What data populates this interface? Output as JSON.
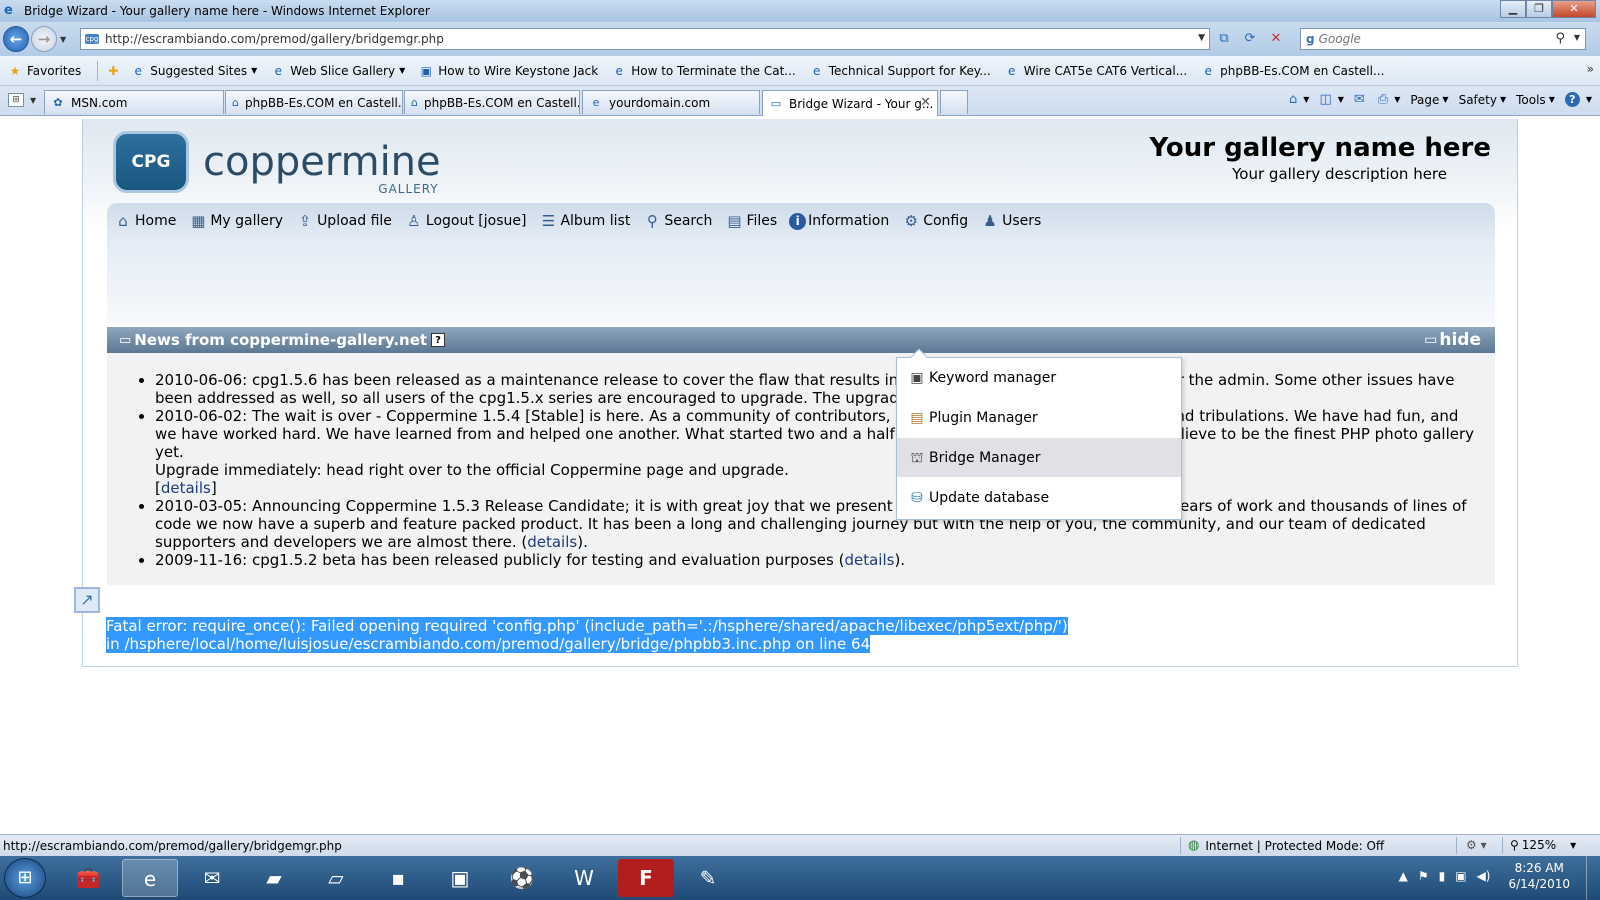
{
  "window": {
    "title": "Bridge Wizard - Your gallery name here - Windows Internet Explorer",
    "minimize": "▁",
    "maximize": "❐",
    "close": "✕"
  },
  "address_bar": {
    "url": "http://escrambiando.com/premod/gallery/bridgemgr.php",
    "search_placeholder": "Google"
  },
  "favorites_bar": {
    "favorites_label": "Favorites",
    "items": [
      "Suggested Sites",
      "Web Slice Gallery",
      "How to Wire Keystone Jack",
      "How to Terminate the Cat...",
      "Technical Support for Key...",
      "Wire CAT5e CAT6 Vertical...",
      "phpBB-Es.COM en Castell..."
    ]
  },
  "tabs": [
    {
      "label": "MSN.com"
    },
    {
      "label": "phpBB-Es.COM en Castell..."
    },
    {
      "label": "phpBB-Es.COM en Castell..."
    },
    {
      "label": "yourdomain.com"
    },
    {
      "label": "Bridge Wizard - Your g..."
    }
  ],
  "command_bar": {
    "page": "Page",
    "safety": "Safety",
    "tools": "Tools",
    "help": "?"
  },
  "gallery": {
    "logo_abbrev": "CPG",
    "logo_name": "coppermine",
    "logo_sub": "GALLERY",
    "title": "Your gallery name here",
    "description": "Your gallery description here"
  },
  "menu": [
    {
      "label": "Home",
      "icon": "home-icon"
    },
    {
      "label": "My gallery",
      "icon": "my-gallery-icon"
    },
    {
      "label": "Upload file",
      "icon": "upload-icon"
    },
    {
      "label": "Logout [josue]",
      "icon": "logout-icon"
    },
    {
      "label": "Album list",
      "icon": "album-list-icon"
    },
    {
      "label": "Search",
      "icon": "search-icon"
    },
    {
      "label": "Files",
      "icon": "files-icon"
    },
    {
      "label": "Information",
      "icon": "information-icon"
    },
    {
      "label": "Config",
      "icon": "gear-icon"
    },
    {
      "label": "Users",
      "icon": "users-icon"
    }
  ],
  "config_dropdown": [
    {
      "label": "Keyword manager"
    },
    {
      "label": "Plugin Manager"
    },
    {
      "label": "Bridge Manager"
    },
    {
      "label": "Update database"
    }
  ],
  "news": {
    "title": "News from coppermine-gallery.net",
    "help": "?",
    "hide": "hide",
    "items": [
      {
        "text": "2010-06-06: cpg1.5.6 has been released as a maintenance release to cover the flaw that results in an error message being displayed for the admin. Some other issues have been addressed as well, so all users of the cpg1.5.x series are encouraged to upgrade. The upgrade is not security-related."
      },
      {
        "text": "2010-06-02: The wait is over - Coppermine 1.5.4 [Stable] is here. As a community of contributors, we have been through celebrations and tribulations. We have had fun, and we have worked hard. We have learned from and helped one another. What started two and a half years ago has grown into what we believe to be the finest PHP photo gallery yet.",
        "line2": "Upgrade immediately: head right over to the official Coppermine page and upgrade.",
        "link": "details"
      },
      {
        "text": "2010-03-05: Announcing Coppermine 1.5.3 Release Candidate; it is with great joy that we present Coppermine 1.5.3 [RC]. After over 2 years of work and thousands of lines of code we now have a superb and feature packed product. It has been a long and challenging journey but with the help of you, the community, and our team of dedicated supporters and developers we are almost there. (",
        "link": "details",
        "tail": ")."
      },
      {
        "text": "2009-11-16: cpg1.5.2 beta has been released publicly for testing and evaluation purposes (",
        "link": "details",
        "tail": ")."
      }
    ]
  },
  "error": {
    "line1": "Fatal error: require_once(): Failed opening required 'config.php' (include_path='.:/hsphere/shared/apache/libexec/php5ext/php/')",
    "line2": "in /hsphere/local/home/luisjosue/escrambiando.com/premod/gallery/bridge/phpbb3.inc.php on line 64"
  },
  "status_bar": {
    "url": "http://escrambiando.com/premod/gallery/bridgemgr.php",
    "zone": "Internet | Protected Mode: Off",
    "zoom": "125%"
  },
  "taskbar": {
    "time": "8:26 AM",
    "date": "6/14/2010"
  },
  "colors": {
    "selection": "#3399ff",
    "news_header": "#5c7894",
    "link": "#1e3b7a"
  }
}
